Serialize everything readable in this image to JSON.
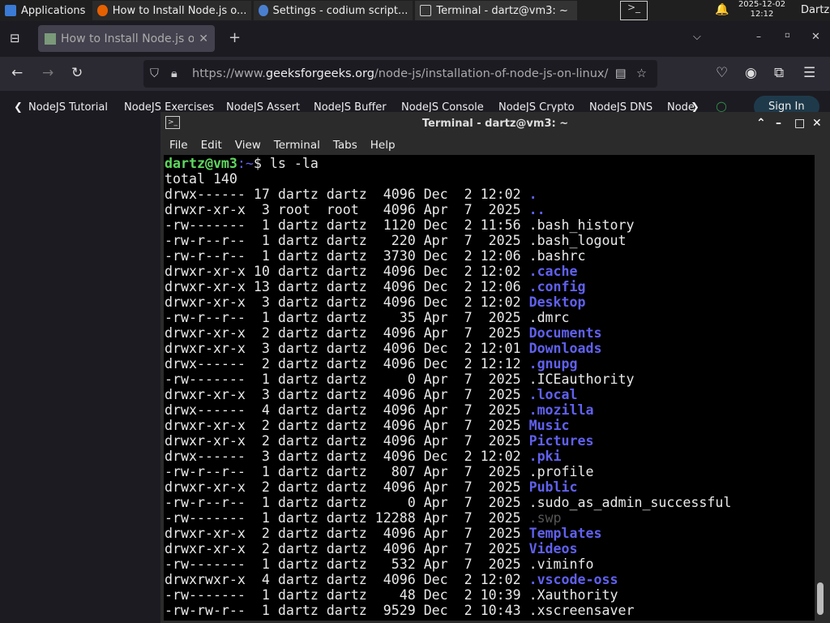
{
  "panel": {
    "apps": "Applications",
    "tasks": [
      "How to Install Node.js o...",
      "Settings - codium script...",
      "Terminal - dartz@vm3: ~"
    ],
    "date": "2025-12-02",
    "time": "12:12",
    "user": "Dartz"
  },
  "browser": {
    "tab_title": "How to Install Node.js on",
    "url_pre": "https://www.",
    "url_domain": "geeksforgeeks.org",
    "url_path": "/node-js/installation-of-node-js-on-linux/",
    "bookmarks": [
      "NodeJS Tutorial",
      "NodeJS Exercises",
      "NodeJS Assert",
      "NodeJS Buffer",
      "NodeJS Console",
      "NodeJS Crypto",
      "NodeJS DNS",
      "Node"
    ],
    "signin": "Sign In"
  },
  "terminal": {
    "title": "Terminal - dartz@vm3: ~",
    "menu": [
      "File",
      "Edit",
      "View",
      "Terminal",
      "Tabs",
      "Help"
    ],
    "prompt_user": "dartz@vm3",
    "prompt_path": ":~",
    "prompt_sym": "$ ",
    "command": "ls -la",
    "total": "total 140",
    "rows": [
      [
        "drwx------ 17 dartz dartz  4096 Dec  2 12:02 ",
        ".",
        "dir"
      ],
      [
        "drwxr-xr-x  3 root  root   4096 Apr  7  2025 ",
        "..",
        "dir"
      ],
      [
        "-rw-------  1 dartz dartz  1120 Dec  2 11:56 ",
        ".bash_history",
        "file"
      ],
      [
        "-rw-r--r--  1 dartz dartz   220 Apr  7  2025 ",
        ".bash_logout",
        "file"
      ],
      [
        "-rw-r--r--  1 dartz dartz  3730 Dec  2 12:06 ",
        ".bashrc",
        "file"
      ],
      [
        "drwxr-xr-x 10 dartz dartz  4096 Dec  2 12:02 ",
        ".cache",
        "dir"
      ],
      [
        "drwxr-xr-x 13 dartz dartz  4096 Dec  2 12:06 ",
        ".config",
        "dir"
      ],
      [
        "drwxr-xr-x  3 dartz dartz  4096 Dec  2 12:02 ",
        "Desktop",
        "dir"
      ],
      [
        "-rw-r--r--  1 dartz dartz    35 Apr  7  2025 ",
        ".dmrc",
        "file"
      ],
      [
        "drwxr-xr-x  2 dartz dartz  4096 Apr  7  2025 ",
        "Documents",
        "dir"
      ],
      [
        "drwxr-xr-x  3 dartz dartz  4096 Dec  2 12:01 ",
        "Downloads",
        "dir"
      ],
      [
        "drwx------  2 dartz dartz  4096 Dec  2 12:12 ",
        ".gnupg",
        "dir"
      ],
      [
        "-rw-------  1 dartz dartz     0 Apr  7  2025 ",
        ".ICEauthority",
        "file"
      ],
      [
        "drwxr-xr-x  3 dartz dartz  4096 Apr  7  2025 ",
        ".local",
        "dir"
      ],
      [
        "drwx------  4 dartz dartz  4096 Apr  7  2025 ",
        ".mozilla",
        "dir"
      ],
      [
        "drwxr-xr-x  2 dartz dartz  4096 Apr  7  2025 ",
        "Music",
        "dir"
      ],
      [
        "drwxr-xr-x  2 dartz dartz  4096 Apr  7  2025 ",
        "Pictures",
        "dir"
      ],
      [
        "drwx------  3 dartz dartz  4096 Dec  2 12:02 ",
        ".pki",
        "dir"
      ],
      [
        "-rw-r--r--  1 dartz dartz   807 Apr  7  2025 ",
        ".profile",
        "file"
      ],
      [
        "drwxr-xr-x  2 dartz dartz  4096 Apr  7  2025 ",
        "Public",
        "dir"
      ],
      [
        "-rw-r--r--  1 dartz dartz     0 Apr  7  2025 ",
        ".sudo_as_admin_successful",
        "file"
      ],
      [
        "-rw-------  1 dartz dartz 12288 Apr  7  2025 ",
        ".swp",
        "swp"
      ],
      [
        "drwxr-xr-x  2 dartz dartz  4096 Apr  7  2025 ",
        "Templates",
        "dir"
      ],
      [
        "drwxr-xr-x  2 dartz dartz  4096 Apr  7  2025 ",
        "Videos",
        "dir"
      ],
      [
        "-rw-------  1 dartz dartz   532 Apr  7  2025 ",
        ".viminfo",
        "file"
      ],
      [
        "drwxrwxr-x  4 dartz dartz  4096 Dec  2 12:02 ",
        ".vscode-oss",
        "dir"
      ],
      [
        "-rw-------  1 dartz dartz    48 Dec  2 10:39 ",
        ".Xauthority",
        "file"
      ],
      [
        "-rw-rw-r--  1 dartz dartz  9529 Dec  2 10:43 ",
        ".xscreensaver",
        "file"
      ]
    ]
  },
  "colors": {
    "prompt": "#5fd75f",
    "directory": "#6060ee",
    "terminal_bg": "#000000"
  }
}
